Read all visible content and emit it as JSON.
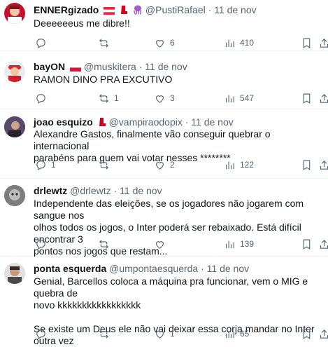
{
  "tweets": [
    {
      "name": "ENNERgizado",
      "handle": "@PustiRafael",
      "time": "11 de nov",
      "text": [
        "Deeeeeeus me dibre!!"
      ],
      "replies": "",
      "retweets": "",
      "likes": "6",
      "views": "410"
    },
    {
      "name": "bayON",
      "handle": "@muskitera",
      "time": "11 de nov",
      "text": [
        "RAMON DINO PRA EXCUTIVO"
      ],
      "replies": "",
      "retweets": "1",
      "likes": "3",
      "views": "547"
    },
    {
      "name": "joao esquizo",
      "handle": "@vampiraodopix",
      "time": "11 de nov",
      "text": [
        "Alexandre Gastos, finalmente vão conseguir quebrar o internacional",
        "parabéns para quem vai votar nesses ********"
      ],
      "replies": "1",
      "retweets": "",
      "likes": "2",
      "views": "122"
    },
    {
      "name": "drlewtz",
      "handle": "@drlewtz",
      "time": "11 de nov",
      "text": [
        "Independente das eleições, se os jogadores não jogarem com sangue nos",
        "olhos todos os jogos, o Inter poderá ser rebaixado. Está difícil encontrar 3",
        "pontos nos jogos que restam..."
      ],
      "replies": "",
      "retweets": "",
      "likes": "",
      "views": "139"
    },
    {
      "name": "ponta esquerda",
      "handle": "@umpontaesquerda",
      "time": "11 de nov",
      "text": [
        "Genial, Barcellos coloca a máquina pra funcionar, vem o MIG e quebra de",
        "novo kkkkkkkkkkkkkkkkk",
        "",
        "Se existe um Deus ele não vai deixar essa corja mandar no Inter outra vez"
      ],
      "replies": "",
      "retweets": "",
      "likes": "1",
      "views": "65"
    }
  ]
}
